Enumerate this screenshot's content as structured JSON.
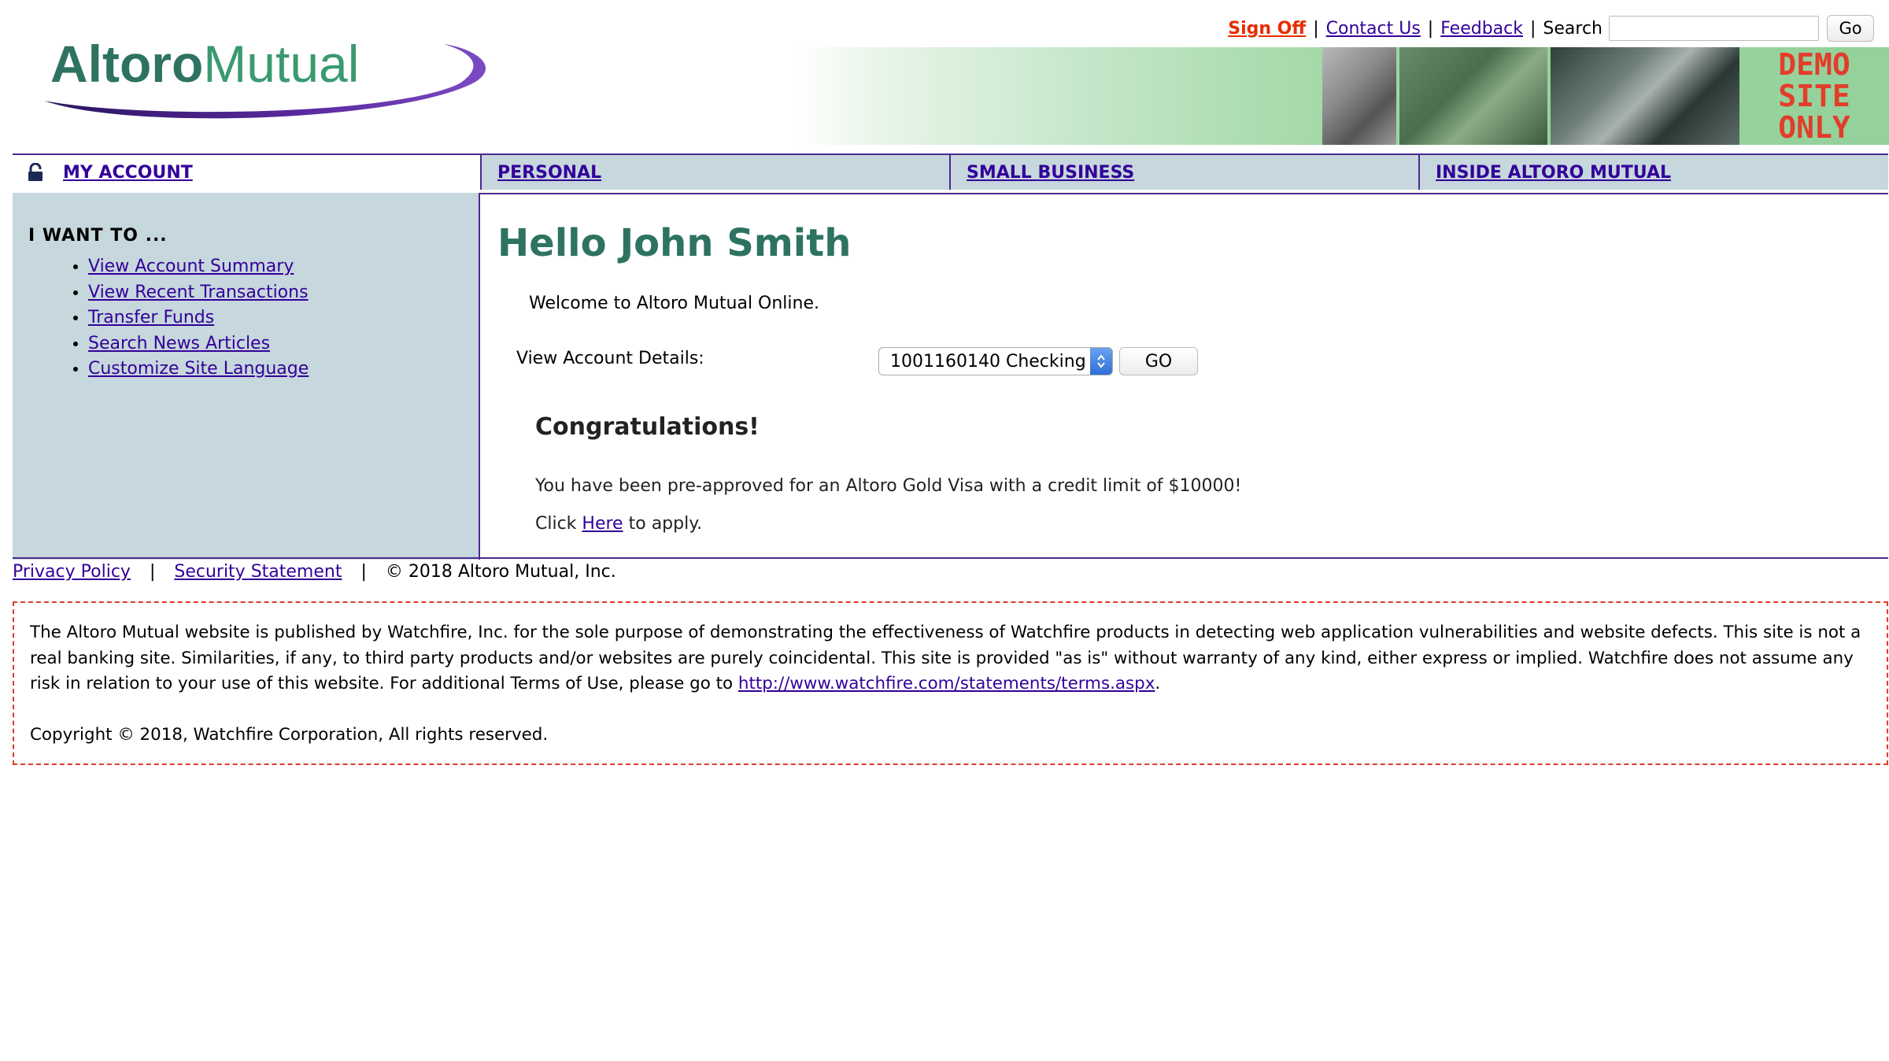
{
  "header": {
    "logo": {
      "part1": "Altoro",
      "part2": "Mutual"
    },
    "sign_off": "Sign Off",
    "contact_us": "Contact Us",
    "feedback": "Feedback",
    "separator": "|",
    "search_label": "Search",
    "search_value": "",
    "search_go": "Go",
    "banner": {
      "demo_line1": "DEMO",
      "demo_line2": "SITE",
      "demo_line3": "ONLY"
    }
  },
  "nav": {
    "my_account": "MY ACCOUNT",
    "personal": "PERSONAL",
    "small_business": "SMALL BUSINESS",
    "inside": "INSIDE ALTORO MUTUAL"
  },
  "sidebar": {
    "title": "I WANT TO ...",
    "items": [
      {
        "label": "View Account Summary"
      },
      {
        "label": "View Recent Transactions"
      },
      {
        "label": "Transfer Funds"
      },
      {
        "label": "Search News Articles"
      },
      {
        "label": "Customize Site Language"
      }
    ]
  },
  "main": {
    "greeting": "Hello John Smith",
    "welcome": "Welcome to Altoro Mutual Online.",
    "view_account_label": "View Account Details:",
    "account_selected": "1001160140 Checking",
    "account_go": "GO",
    "congrats": "Congratulations!",
    "offer": "You have been pre-approved for an Altoro Gold Visa with a credit limit of $10000!",
    "apply_prefix": "Click",
    "apply_link": "Here",
    "apply_suffix": "to apply."
  },
  "footer": {
    "privacy": "Privacy Policy",
    "security": "Security Statement",
    "separator": "|",
    "copyright": "© 2018 Altoro Mutual, Inc."
  },
  "disclaimer": {
    "text_before_link": "The Altoro Mutual website is published by Watchfire, Inc. for the sole purpose of demonstrating the effectiveness of Watchfire products in detecting web application vulnerabilities and website defects. This site is not a real banking site. Similarities, if any, to third party products and/or websites are purely coincidental. This site is provided \"as is\" without warranty of any kind, either express or implied. Watchfire does not assume any risk in relation to your use of this website. For additional Terms of Use, please go to ",
    "link": "http://www.watchfire.com/statements/terms.aspx",
    "text_after_link": ".",
    "copyright": "Copyright © 2018, Watchfire Corporation, All rights reserved."
  },
  "colors": {
    "nav_border": "#4b2a8f",
    "nav_bg": "#c6d7dd",
    "link": "#330099",
    "sign_off": "#e62e00",
    "greeting": "#2e7361",
    "disclaimer_border": "#e03a30",
    "logo_text": "#2e7361",
    "logo_swoosh": "#5b2aa0"
  }
}
